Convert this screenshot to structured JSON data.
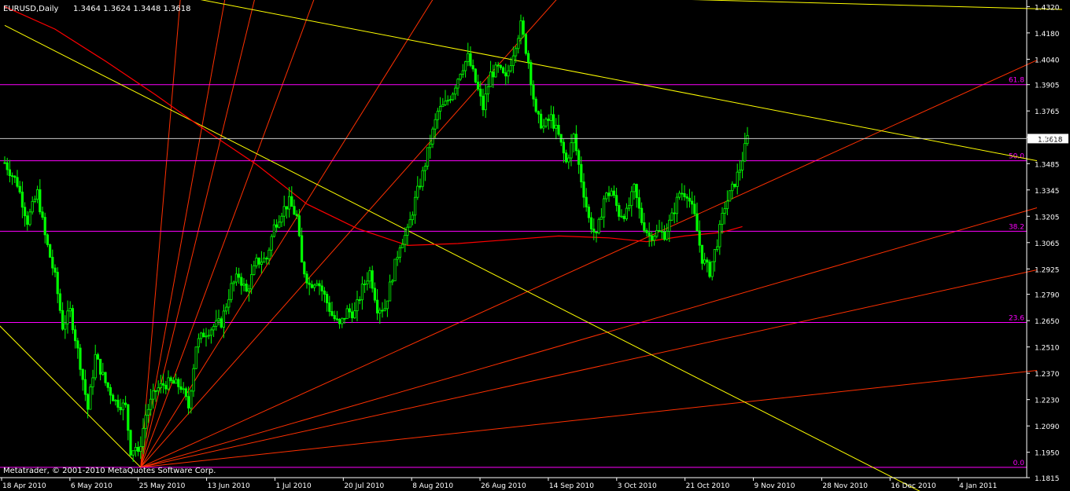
{
  "header": {
    "symbol_tf": "EURUSD,Daily",
    "ohlc": "1.3464 1.3624 1.3448 1.3618"
  },
  "footer": {
    "copyright": "Metatrader, © 2001-2010 MetaQuotes Software Corp."
  },
  "colors": {
    "background": "#000000",
    "candle_up": "#00ff00",
    "candle_down": "#00ff00",
    "fib": "#ff00ff",
    "fib_label": "#ff00ff",
    "trendline": "#ffff00",
    "gann_fan": "#ff3000",
    "moving_average": "#ff0000",
    "price_line": "#c8c8c8",
    "axis": "#ffffff",
    "text": "#ffffff"
  },
  "chart_data": {
    "type": "candlestick",
    "symbol": "EURUSD",
    "timeframe": "Daily",
    "ylim": [
      1.1815,
      1.4355
    ],
    "yticks": [
      "1.4320",
      "1.4180",
      "1.4040",
      "1.3905",
      "1.3765",
      "1.3625",
      "1.3485",
      "1.3345",
      "1.3205",
      "1.3065",
      "1.2925",
      "1.2790",
      "1.2650",
      "1.2510",
      "1.2370",
      "1.2230",
      "1.2090",
      "1.1950",
      "1.1815"
    ],
    "xticks": [
      "18 Apr 2010",
      "6 May 2010",
      "25 May 2010",
      "13 Jun 2010",
      "1 Jul 2010",
      "20 Jul 2010",
      "8 Aug 2010",
      "26 Aug 2010",
      "14 Sep 2010",
      "3 Oct 2010",
      "21 Oct 2010",
      "9 Nov 2010",
      "28 Nov 2010",
      "16 Dec 2010",
      "4 Jan 2011"
    ],
    "current_price": {
      "label": "1.3618",
      "value": 1.3618
    },
    "fib_levels": [
      {
        "label": "61.8",
        "price": 1.3905
      },
      {
        "label": "50.0",
        "price": 1.35
      },
      {
        "label": "38.2",
        "price": 1.3125
      },
      {
        "label": "23.6",
        "price": 1.264
      },
      {
        "label": "0.0",
        "price": 1.187
      }
    ],
    "series_close": [
      [
        0,
        1.349
      ],
      [
        5,
        1.338
      ],
      [
        9,
        1.318
      ],
      [
        13,
        1.333
      ],
      [
        16,
        1.31
      ],
      [
        20,
        1.288
      ],
      [
        23,
        1.262
      ],
      [
        26,
        1.27
      ],
      [
        30,
        1.242
      ],
      [
        33,
        1.218
      ],
      [
        36,
        1.246
      ],
      [
        40,
        1.232
      ],
      [
        44,
        1.222
      ],
      [
        48,
        1.219
      ],
      [
        50,
        1.196
      ],
      [
        52,
        1.198
      ],
      [
        53,
        1.193
      ],
      [
        56,
        1.215
      ],
      [
        60,
        1.228
      ],
      [
        63,
        1.231
      ],
      [
        66,
        1.232
      ],
      [
        70,
        1.23
      ],
      [
        73,
        1.219
      ],
      [
        76,
        1.252
      ],
      [
        79,
        1.258
      ],
      [
        83,
        1.262
      ],
      [
        86,
        1.264
      ],
      [
        90,
        1.283
      ],
      [
        93,
        1.289
      ],
      [
        96,
        1.28
      ],
      [
        100,
        1.296
      ],
      [
        104,
        1.298
      ],
      [
        107,
        1.315
      ],
      [
        110,
        1.323
      ],
      [
        113,
        1.328
      ],
      [
        116,
        1.32
      ],
      [
        118,
        1.295
      ],
      [
        121,
        1.284
      ],
      [
        124,
        1.287
      ],
      [
        127,
        1.278
      ],
      [
        130,
        1.268
      ],
      [
        133,
        1.262
      ],
      [
        136,
        1.27
      ],
      [
        139,
        1.269
      ],
      [
        142,
        1.282
      ],
      [
        145,
        1.291
      ],
      [
        148,
        1.272
      ],
      [
        151,
        1.272
      ],
      [
        154,
        1.289
      ],
      [
        157,
        1.306
      ],
      [
        160,
        1.312
      ],
      [
        163,
        1.329
      ],
      [
        166,
        1.343
      ],
      [
        169,
        1.36
      ],
      [
        172,
        1.376
      ],
      [
        175,
        1.38
      ],
      [
        178,
        1.387
      ],
      [
        181,
        1.398
      ],
      [
        184,
        1.405
      ],
      [
        187,
        1.392
      ],
      [
        190,
        1.378
      ],
      [
        193,
        1.396
      ],
      [
        196,
        1.399
      ],
      [
        199,
        1.393
      ],
      [
        202,
        1.408
      ],
      [
        205,
        1.422
      ],
      [
        208,
        1.403
      ],
      [
        211,
        1.374
      ],
      [
        214,
        1.368
      ],
      [
        217,
        1.373
      ],
      [
        220,
        1.363
      ],
      [
        223,
        1.349
      ],
      [
        226,
        1.363
      ],
      [
        229,
        1.34
      ],
      [
        232,
        1.319
      ],
      [
        235,
        1.309
      ],
      [
        238,
        1.33
      ],
      [
        241,
        1.334
      ],
      [
        244,
        1.322
      ],
      [
        247,
        1.322
      ],
      [
        250,
        1.335
      ],
      [
        253,
        1.318
      ],
      [
        256,
        1.31
      ],
      [
        259,
        1.312
      ],
      [
        262,
        1.311
      ],
      [
        265,
        1.32
      ],
      [
        268,
        1.333
      ],
      [
        271,
        1.333
      ],
      [
        274,
        1.32
      ],
      [
        277,
        1.298
      ],
      [
        280,
        1.291
      ],
      [
        283,
        1.307
      ],
      [
        286,
        1.326
      ],
      [
        289,
        1.335
      ],
      [
        292,
        1.346
      ],
      [
        295,
        1.362
      ]
    ],
    "moving_average": [
      [
        0,
        1.432
      ],
      [
        20,
        1.42
      ],
      [
        40,
        1.403
      ],
      [
        60,
        1.385
      ],
      [
        80,
        1.366
      ],
      [
        100,
        1.348
      ],
      [
        120,
        1.327
      ],
      [
        140,
        1.314
      ],
      [
        160,
        1.305
      ],
      [
        180,
        1.306
      ],
      [
        200,
        1.308
      ],
      [
        220,
        1.31
      ],
      [
        240,
        1.309
      ],
      [
        255,
        1.307
      ],
      [
        270,
        1.31
      ],
      [
        285,
        1.312
      ],
      [
        293,
        1.315
      ]
    ],
    "trendlines": [
      {
        "from": [
          0,
          1.422
        ],
        "to": [
          380,
          1.163
        ]
      },
      {
        "from": [
          65,
          1.439
        ],
        "to": [
          410,
          1.35
        ]
      },
      {
        "from": [
          180,
          1.439
        ],
        "to": [
          420,
          1.4305
        ]
      },
      {
        "from": [
          -10,
          1.273
        ],
        "to": [
          54,
          1.187
        ]
      }
    ],
    "gann_fan": {
      "origin": [
        54,
        1.187
      ],
      "targets": [
        [
          70,
          1.44
        ],
        [
          88,
          1.44
        ],
        [
          100,
          1.44
        ],
        [
          124,
          1.44
        ],
        [
          172,
          1.44
        ],
        [
          222,
          1.44
        ],
        [
          410,
          1.4035
        ],
        [
          410,
          1.325
        ],
        [
          410,
          1.292
        ],
        [
          410,
          1.2385
        ]
      ]
    }
  }
}
